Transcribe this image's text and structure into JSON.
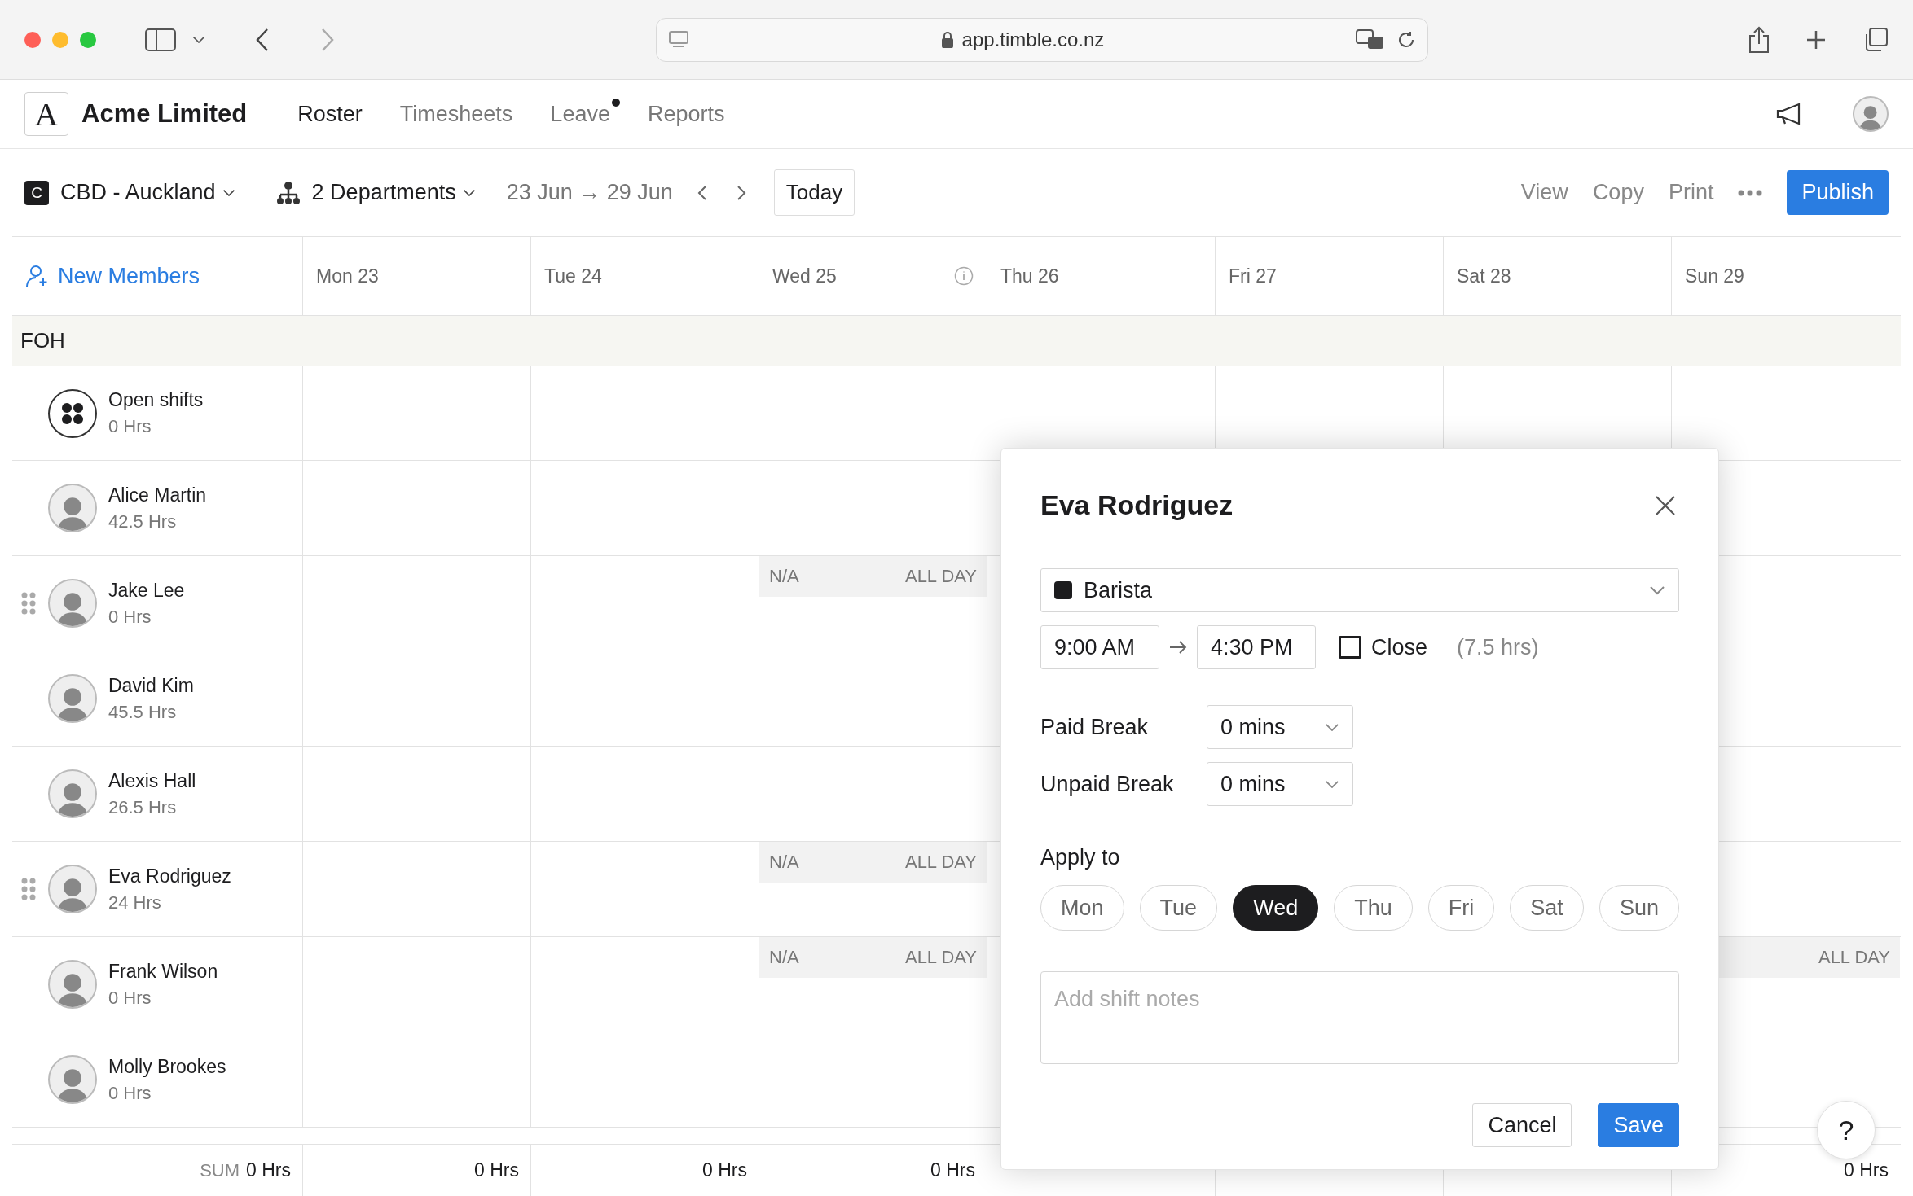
{
  "browser": {
    "url": "app.timble.co.nz"
  },
  "header": {
    "logo_letter": "A",
    "company": "Acme Limited",
    "nav": [
      {
        "label": "Roster",
        "selected": true,
        "badge": false
      },
      {
        "label": "Timesheets",
        "selected": false,
        "badge": false
      },
      {
        "label": "Leave",
        "selected": false,
        "badge": true
      },
      {
        "label": "Reports",
        "selected": false,
        "badge": false
      }
    ]
  },
  "toolbar": {
    "location_badge": "C",
    "location": "CBD - Auckland",
    "departments": "2 Departments",
    "date_range": "23 Jun → 29 Jun",
    "today": "Today",
    "actions": [
      "View",
      "Copy",
      "Print"
    ],
    "publish": "Publish"
  },
  "roster": {
    "new_members": "New Members",
    "days": [
      {
        "label": "Mon 23",
        "info": false,
        "sum": "0 Hrs"
      },
      {
        "label": "Tue 24",
        "info": false,
        "sum": "0 Hrs"
      },
      {
        "label": "Wed 25",
        "info": true,
        "sum": "0 Hrs"
      },
      {
        "label": "Thu 26",
        "info": false
      },
      {
        "label": "Fri 27",
        "info": false
      },
      {
        "label": "Sat 28",
        "info": false
      },
      {
        "label": "Sun 29",
        "info": false,
        "sum": "0 Hrs"
      }
    ],
    "group": "FOH",
    "members": [
      {
        "kind": "open",
        "name": "Open shifts",
        "hours": "0 Hrs",
        "draggable": false,
        "cells": [
          null,
          null,
          null,
          null,
          null,
          null,
          null
        ]
      },
      {
        "kind": "person",
        "name": "Alice Martin",
        "hours": "42.5 Hrs",
        "draggable": false,
        "cells": [
          null,
          null,
          null,
          null,
          null,
          null,
          null
        ]
      },
      {
        "kind": "person",
        "name": "Jake Lee",
        "hours": "0 Hrs",
        "draggable": true,
        "cells": [
          null,
          null,
          {
            "left": "N/A",
            "right": "ALL DAY"
          },
          null,
          null,
          null,
          null
        ]
      },
      {
        "kind": "person",
        "name": "David Kim",
        "hours": "45.5 Hrs",
        "draggable": false,
        "cells": [
          null,
          null,
          null,
          null,
          null,
          null,
          null
        ]
      },
      {
        "kind": "person",
        "name": "Alexis Hall",
        "hours": "26.5 Hrs",
        "draggable": false,
        "cells": [
          null,
          null,
          null,
          null,
          null,
          null,
          null
        ]
      },
      {
        "kind": "person",
        "name": "Eva Rodriguez",
        "hours": "24 Hrs",
        "draggable": true,
        "cells": [
          null,
          null,
          {
            "left": "N/A",
            "right": "ALL DAY"
          },
          null,
          null,
          null,
          null
        ]
      },
      {
        "kind": "person",
        "name": "Frank Wilson",
        "hours": "0 Hrs",
        "draggable": false,
        "cells": [
          null,
          null,
          {
            "left": "N/A",
            "right": "ALL DAY"
          },
          null,
          null,
          null,
          {
            "right": "ALL DAY"
          }
        ]
      },
      {
        "kind": "person",
        "name": "Molly Brookes",
        "hours": "0 Hrs",
        "draggable": false,
        "cells": [
          null,
          null,
          null,
          null,
          null,
          null,
          null
        ]
      }
    ],
    "sum_label": "SUM",
    "sum_total": "0 Hrs"
  },
  "dialog": {
    "title": "Eva Rodriguez",
    "role": {
      "label": "Barista",
      "color": "#1c1c1e"
    },
    "start": "9:00 AM",
    "end": "4:30 PM",
    "close": {
      "label": "Close",
      "checked": false
    },
    "duration": "(7.5 hrs)",
    "breaks": [
      {
        "label": "Paid Break",
        "value": "0 mins"
      },
      {
        "label": "Unpaid Break",
        "value": "0 mins"
      }
    ],
    "apply_label": "Apply to",
    "apply_days": [
      {
        "label": "Mon",
        "selected": false
      },
      {
        "label": "Tue",
        "selected": false
      },
      {
        "label": "Wed",
        "selected": true
      },
      {
        "label": "Thu",
        "selected": false
      },
      {
        "label": "Fri",
        "selected": false
      },
      {
        "label": "Sat",
        "selected": false
      },
      {
        "label": "Sun",
        "selected": false
      }
    ],
    "notes": {
      "placeholder": "Add shift notes"
    },
    "buttons": [
      {
        "kind": "secondary",
        "label": "Cancel"
      },
      {
        "kind": "primary",
        "label": "Save"
      }
    ]
  },
  "help": "?"
}
